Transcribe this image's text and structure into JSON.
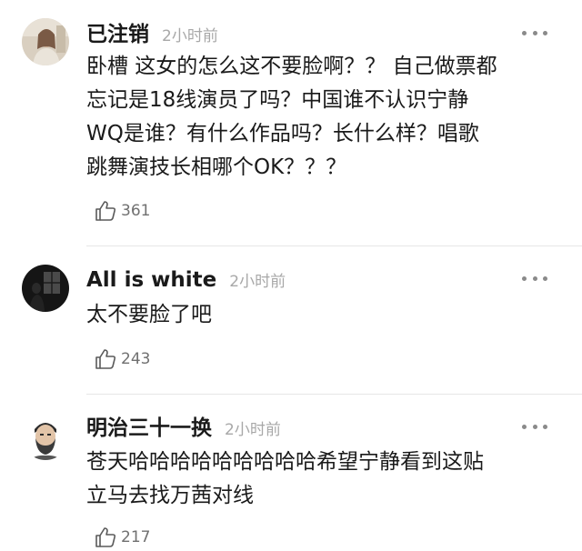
{
  "comments": [
    {
      "username": "已注销",
      "time": "2小时前",
      "lines": [
        "卧槽 这女的怎么这不要脸啊？？ 自己做票都",
        "忘记是18线演员了吗？中国谁不认识宁静",
        "WQ是谁？有什么作品吗？长什么样？唱歌",
        "跳舞演技长相哪个OK？？？"
      ],
      "likes": "361",
      "avatar_icon": "woman-photo-avatar",
      "more_icon": "more-dots-icon",
      "like_icon": "thumbs-up-icon"
    },
    {
      "username": "All is white",
      "time": "2小时前",
      "lines": [
        "太不要脸了吧"
      ],
      "likes": "243",
      "avatar_icon": "dark-window-photo-avatar",
      "more_icon": "more-dots-icon",
      "like_icon": "thumbs-up-icon"
    },
    {
      "username": "明治三十一换",
      "time": "2小时前",
      "lines": [
        "苍天哈哈哈哈哈哈哈哈哈希望宁静看到这贴",
        "立马去找万茜对线"
      ],
      "likes": "217",
      "avatar_icon": "bearded-man-avatar",
      "more_icon": "more-dots-icon",
      "like_icon": "thumbs-up-icon"
    }
  ],
  "colors": {
    "text": "#1a1a1a",
    "muted": "#a8a8a8",
    "like_count": "#707070",
    "divider": "#e6e6e6"
  }
}
